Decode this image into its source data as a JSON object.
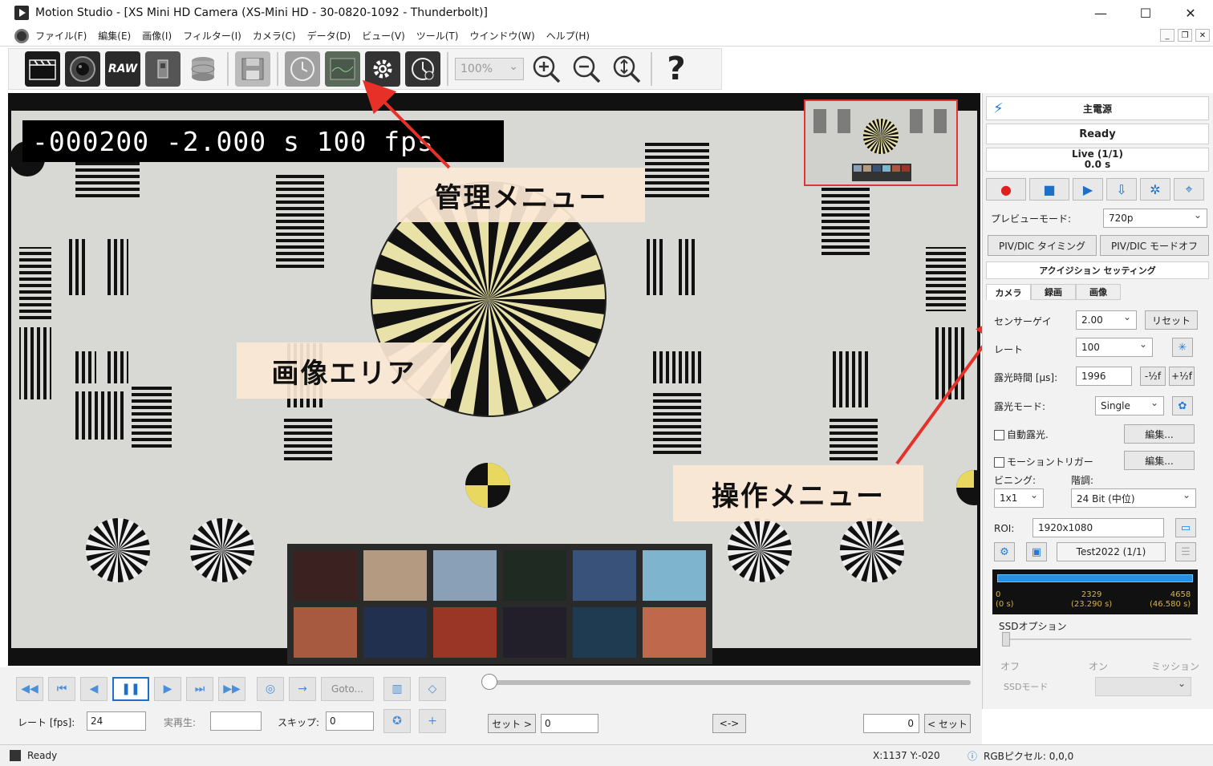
{
  "window": {
    "title": "Motion Studio - [XS Mini HD Camera (XS-Mini HD - 30-0820-1092 - Thunderbolt)]",
    "minimize": "—",
    "maximize": "☐",
    "close": "✕"
  },
  "menu": [
    "ファイル(F)",
    "編集(E)",
    "画像(I)",
    "フィルター(I)",
    "カメラ(C)",
    "データ(D)",
    "ビュー(V)",
    "ツール(T)",
    "ウインドウ(W)",
    "ヘルプ(H)"
  ],
  "toolbar": {
    "raw_label": "RAW",
    "zoom_value": "100%",
    "help_label": "?"
  },
  "image": {
    "overlay": "-000200 -2.000 s 100 fps"
  },
  "annotations": {
    "management_menu": "管理メニュー",
    "image_area": "画像エリア",
    "operation_menu": "操作メニュー"
  },
  "panel": {
    "power": "主電源",
    "status": "Ready",
    "live": "Live (1/1)",
    "live_time": "0.0 s",
    "preview_mode_label": "プレビューモード:",
    "preview_mode_value": "720p",
    "piv_timing": "PIV/DIC タイミング",
    "piv_mode": "PIV/DIC モードオフ",
    "acquisition": "アクイジション セッティング",
    "tabs": [
      "カメラ",
      "録画",
      "画像"
    ],
    "sensor_gain_label": "センサーゲイ",
    "sensor_gain_value": "2.00",
    "reset": "リセット",
    "rate_label": "レート",
    "rate_value": "100",
    "exposure_label": "露光時間 [μs]:",
    "exposure_value": "1996",
    "half_minus": "-½f",
    "half_plus": "+½f",
    "exposure_mode_label": "露光モード:",
    "exposure_mode_value": "Single",
    "auto_exposure": "自動露光.",
    "edit": "編集...",
    "motion_trigger": "モーショントリガー",
    "edit2": "編集...",
    "binning_label": "ビニング:",
    "binning_value": "1x1",
    "bit_label": "階調:",
    "bit_value": "24 Bit (中位)",
    "roi_label": "ROI:",
    "roi_value": "1920x1080",
    "test_value": "Test2022 (1/1)",
    "tl_start": "0",
    "tl_start_time": "(0 s)",
    "tl_mid": "2329",
    "tl_mid_time": "(23.290 s)",
    "tl_end": "4658",
    "tl_end_time": "(46.580 s)",
    "ssd_options": "SSDオプション",
    "ssd_off": "オフ",
    "ssd_on": "オン",
    "ssd_mission": "ミッション",
    "ssd_mode_label": "SSDモード"
  },
  "playback": {
    "goto": "Goto...",
    "rate_label": "レート [fps]:",
    "rate_value": "24",
    "realtime_label": "実再生:",
    "skip_label": "スキップ:",
    "skip_value": "0",
    "set_start": "セット >",
    "start_value": "0",
    "swap": "<->",
    "end_value": "0",
    "set_end": "< セット"
  },
  "status": {
    "ready": "Ready",
    "coords": "X:1137  Y:-020",
    "rgb": "RGBピクセル: 0,0,0"
  }
}
